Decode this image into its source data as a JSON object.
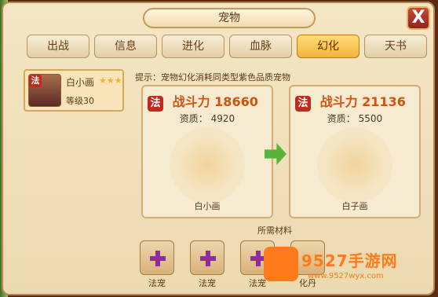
{
  "window": {
    "title": "宠物",
    "close_label": "X"
  },
  "tabs": [
    {
      "label": "出战",
      "active": false
    },
    {
      "label": "信息",
      "active": false
    },
    {
      "label": "进化",
      "active": false
    },
    {
      "label": "血脉",
      "active": false
    },
    {
      "label": "幻化",
      "active": true
    },
    {
      "label": "天书",
      "active": false
    }
  ],
  "selected_pet": {
    "class_badge": "法",
    "name": "白小画",
    "stars": "★★★",
    "level": "等级30"
  },
  "hint": "提示：宠物幻化消耗同类型紫色品质宠物",
  "current_pet": {
    "class_badge": "法",
    "power_label": "战斗力",
    "power": "18660",
    "aptitude_label": "资质：",
    "aptitude": "4920",
    "name": "白小画"
  },
  "target_pet": {
    "class_badge": "法",
    "power_label": "战斗力",
    "power": "21136",
    "aptitude_label": "资质：",
    "aptitude": "5500",
    "name": "白子画"
  },
  "materials": {
    "label": "所需材料",
    "slots": [
      {
        "label": "法宠"
      },
      {
        "label": "法宠"
      },
      {
        "label": "法宠"
      },
      {
        "label": "化丹"
      }
    ]
  },
  "watermark": {
    "main": "9527手游网",
    "sub": "www.9527wyx.com"
  },
  "colors": {
    "accent": "#f1b23b",
    "power": "#d05410",
    "plus": "#8e2b9f",
    "arrow": "#57b33b"
  }
}
